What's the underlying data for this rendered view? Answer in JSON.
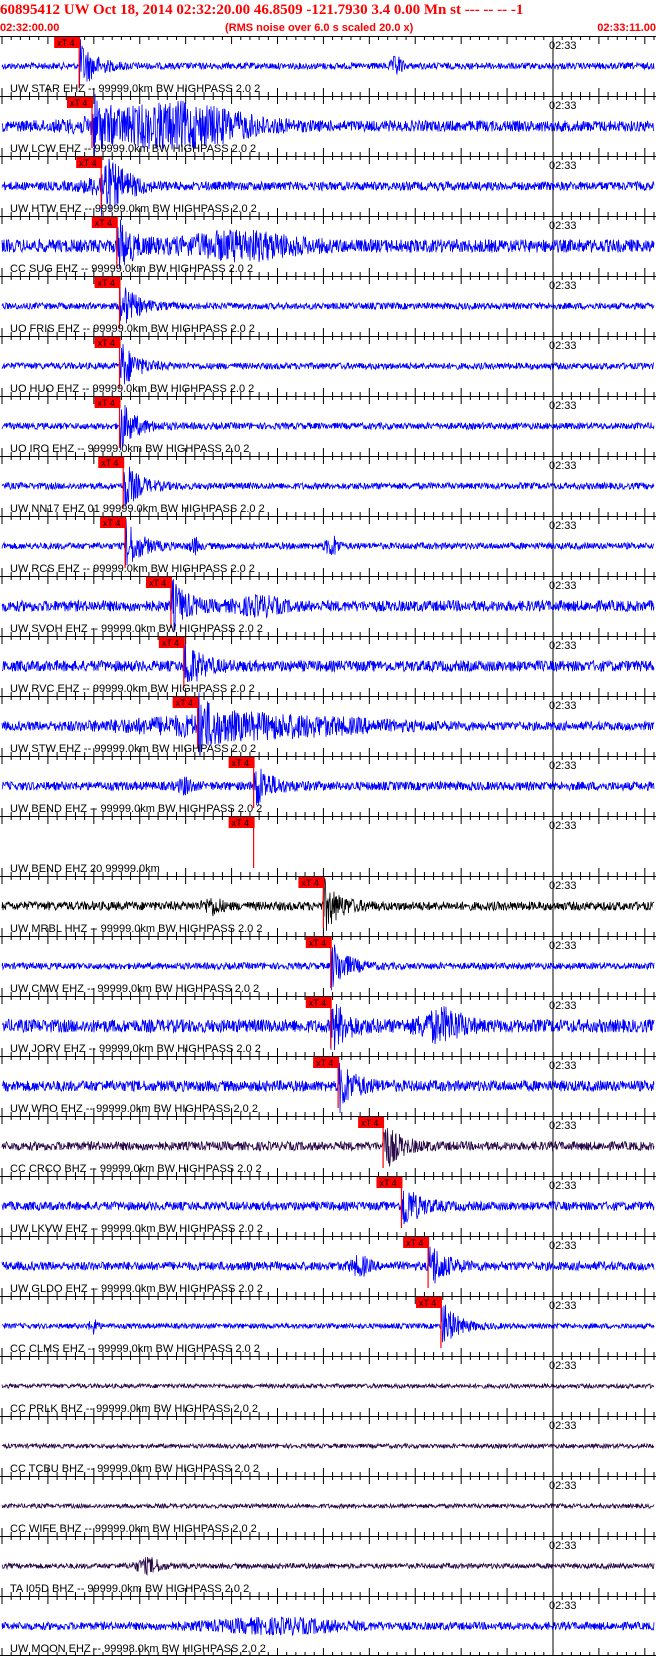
{
  "header": {
    "title": "60895412 UW Oct 18, 2014 02:32:20.00   46.8509 -121.7930  3.4 0.00 Mn st --- -- --  -1",
    "start_time": "02:32:00.00",
    "rms_note": "(RMS noise over 6.0 s scaled 20.0 x)",
    "end_time": "02:33:11.00"
  },
  "colors": {
    "header": "#ff0000",
    "pick": "#ff0000",
    "blue_trace": "#0000ff",
    "black_trace": "#000000",
    "purple_trace": "#2a0a4a"
  },
  "chart_data": {
    "type": "line",
    "title": "60895412 UW Oct 18, 2014 02:32:20.00",
    "x_range": [
      "02:32:00.00",
      "02:33:11.00"
    ],
    "minute_marker": "02:33",
    "pick_label": "xT 4",
    "series": [
      {
        "name": "UW STAR EHZ -- 99999.0km BW  HIGHPASS  2.0  2",
        "pick_s": 8.4,
        "color": "blue",
        "amp": 0.15,
        "burst": [
          [
            43.0,
            0.4,
            1.2
          ]
        ]
      },
      {
        "name": "UW LCW EHZ -- 99999.0km BW  HIGHPASS  2.0  2",
        "pick_s": 9.8,
        "color": "blue",
        "amp": 0.25,
        "burst": [
          [
            19.0,
            0.9,
            16.0
          ]
        ]
      },
      {
        "name": "UW HTW EHZ -- 99999.0km BW  HIGHPASS  2.0  2",
        "pick_s": 10.8,
        "color": "blue",
        "amp": 0.2,
        "burst": [
          [
            12.0,
            0.4,
            6.0
          ]
        ]
      },
      {
        "name": "CC SUG EHZ -- 99999.0km BW  HIGHPASS  2.0  2",
        "pick_s": 12.5,
        "color": "blue",
        "amp": 0.3,
        "burst": [
          [
            26.0,
            0.5,
            12.0
          ]
        ]
      },
      {
        "name": "UO FRIS EHZ -- 99999.0km BW  HIGHPASS  2.0  2",
        "pick_s": 12.8,
        "color": "blue",
        "amp": 0.15,
        "burst": []
      },
      {
        "name": "UO HUO EHZ -- 99999.0km BW  HIGHPASS  2.0  2",
        "pick_s": 12.8,
        "color": "blue",
        "amp": 0.15,
        "burst": []
      },
      {
        "name": "UO IRO EHZ -- 99999.0km BW  HIGHPASS  2.0  2",
        "pick_s": 12.8,
        "color": "blue",
        "amp": 0.15,
        "burst": []
      },
      {
        "name": "UW NN17 EHZ 01 99999.0km BW  HIGHPASS  2.0  2",
        "pick_s": 13.2,
        "color": "blue",
        "amp": 0.15,
        "burst": []
      },
      {
        "name": "UW RCS EHZ -- 99999.0km BW  HIGHPASS  2.0  2",
        "pick_s": 13.4,
        "color": "blue",
        "amp": 0.15,
        "burst": [
          [
            21.0,
            0.3,
            1.0
          ],
          [
            36.0,
            0.4,
            1.5
          ]
        ]
      },
      {
        "name": "UW SVOH EHZ -- 99999.0km BW  HIGHPASS  2.0  2",
        "pick_s": 18.4,
        "color": "blue",
        "amp": 0.25,
        "burst": [
          [
            28.0,
            0.3,
            5.0
          ]
        ]
      },
      {
        "name": "UW RVC EHZ -- 99999.0km BW  HIGHPASS  2.0  2",
        "pick_s": 19.8,
        "color": "blue",
        "amp": 0.25,
        "burst": []
      },
      {
        "name": "UW STW EHZ -- 99999.0km BW  HIGHPASS  2.0  2",
        "pick_s": 21.3,
        "color": "blue",
        "amp": 0.2,
        "burst": [
          [
            27.0,
            0.45,
            26.0
          ]
        ]
      },
      {
        "name": "UW BEND EHZ -- 99999.0km BW  HIGHPASS  2.0  2",
        "pick_s": 27.4,
        "color": "blue",
        "amp": 0.2,
        "burst": [
          [
            20.0,
            0.3,
            1.5
          ]
        ]
      },
      {
        "name": "UW BEND EHZ 20 99999.0km",
        "pick_s": 27.4,
        "color": "none",
        "amp": 0.0,
        "burst": []
      },
      {
        "name": "UW MRBL HHZ -- 99999.0km BW  HIGHPASS  2.0  2",
        "pick_s": 35.0,
        "color": "black",
        "amp": 0.2,
        "burst": [
          [
            23.0,
            0.3,
            2.0
          ]
        ]
      },
      {
        "name": "UW CMW EHZ -- 99999.0km BW  HIGHPASS  2.0  2",
        "pick_s": 35.8,
        "color": "blue",
        "amp": 0.15,
        "burst": []
      },
      {
        "name": "UW JORV EHZ -- 99999.0km BW  HIGHPASS  2.0  2",
        "pick_s": 35.8,
        "color": "blue",
        "amp": 0.3,
        "burst": [
          [
            48.0,
            0.6,
            5.0
          ]
        ]
      },
      {
        "name": "UW WPO EHZ -- 99999.0km BW  HIGHPASS  2.0  2",
        "pick_s": 36.6,
        "color": "blue",
        "amp": 0.25,
        "burst": []
      },
      {
        "name": "CC CRCO BHZ -- 99999.0km BW  HIGHPASS  2.0  2",
        "pick_s": 41.5,
        "color": "purple",
        "amp": 0.2,
        "burst": []
      },
      {
        "name": "UW LKVW EHZ -- 99999.0km BW  HIGHPASS  2.0  2",
        "pick_s": 43.5,
        "color": "blue",
        "amp": 0.2,
        "burst": []
      },
      {
        "name": "UW GLDO EHZ -- 99999.0km BW  HIGHPASS  2.0  2",
        "pick_s": 46.4,
        "color": "blue",
        "amp": 0.2,
        "burst": [
          [
            39.0,
            0.35,
            2.0
          ]
        ]
      },
      {
        "name": "CC CLMS EHZ -- 99999.0km BW  HIGHPASS  2.0  2",
        "pick_s": 47.8,
        "color": "blue",
        "amp": 0.12,
        "burst": [
          [
            10.0,
            0.3,
            1.0
          ]
        ]
      },
      {
        "name": "CC PRLK BHZ -- 99999.0km BW  HIGHPASS  2.0  2",
        "pick_s": null,
        "color": "purple",
        "amp": 0.1,
        "burst": []
      },
      {
        "name": "CC TCBU BHZ -- 99999.0km BW  HIGHPASS  2.0  2",
        "pick_s": null,
        "color": "purple",
        "amp": 0.1,
        "burst": []
      },
      {
        "name": "CC WIFE BHZ -- 99999.0km BW  HIGHPASS  2.0  2",
        "pick_s": null,
        "color": "purple",
        "amp": 0.1,
        "burst": []
      },
      {
        "name": "TA I05D BHZ -- 99999.0km BW  HIGHPASS  2.0  2",
        "pick_s": null,
        "color": "purple",
        "amp": 0.12,
        "burst": [
          [
            16.0,
            0.3,
            3.0
          ]
        ]
      },
      {
        "name": "UW MOON EHZ -- 99998.0km BW  HIGHPASS  2.0  2",
        "pick_s": null,
        "color": "blue",
        "amp": 0.18,
        "burst": [
          [
            30.0,
            0.25,
            15.0
          ]
        ]
      }
    ]
  }
}
